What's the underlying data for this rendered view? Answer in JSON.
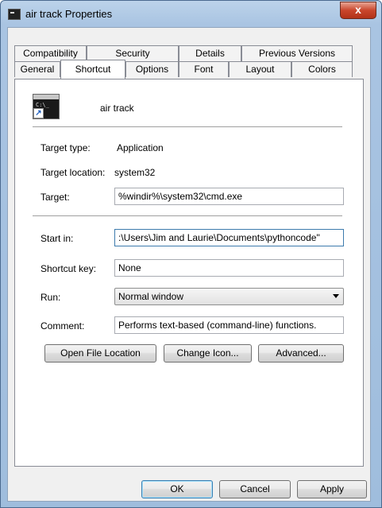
{
  "window": {
    "title": "air track Properties",
    "close_glyph": "x"
  },
  "tabs_back": [
    "Compatibility",
    "Security",
    "Details",
    "Previous Versions"
  ],
  "tabs_front": [
    "General",
    "Shortcut",
    "Options",
    "Font",
    "Layout",
    "Colors"
  ],
  "active_tab": "Shortcut",
  "shortcut": {
    "name": "air track",
    "icon": "command-prompt-shortcut-icon",
    "target_type_label": "Target type:",
    "target_type_value": "Application",
    "target_location_label": "Target location:",
    "target_location_value": "system32",
    "target_label": "Target:",
    "target_value": "%windir%\\system32\\cmd.exe",
    "start_in_label": "Start in:",
    "start_in_value": ":\\Users\\Jim and Laurie\\Documents\\pythoncode\"",
    "shortcut_key_label": "Shortcut key:",
    "shortcut_key_value": "None",
    "run_label": "Run:",
    "run_value": "Normal window",
    "comment_label": "Comment:",
    "comment_value": "Performs text-based (command-line) functions."
  },
  "actions": {
    "open_file_location": "Open File Location",
    "change_icon": "Change Icon...",
    "advanced": "Advanced..."
  },
  "footer": {
    "ok": "OK",
    "cancel": "Cancel",
    "apply": "Apply"
  }
}
